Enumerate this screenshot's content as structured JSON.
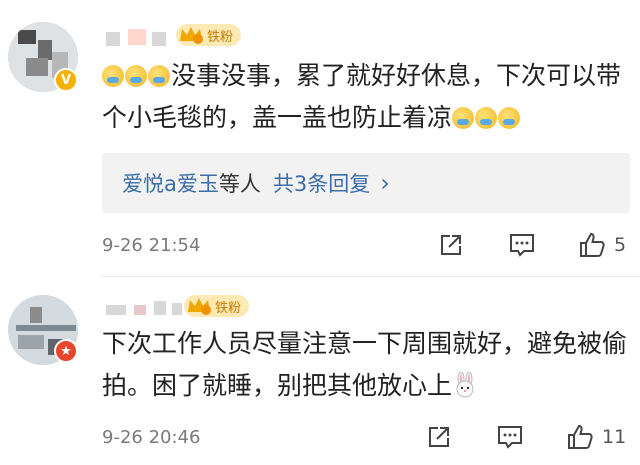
{
  "comments": [
    {
      "fan_badge": "铁粉",
      "text_a": "没事没事，累了就好好休息，下次可以带个小毛毯的，盖一盖也防止着凉",
      "replies": {
        "users": "爱悦a爱玉",
        "mid": "等人",
        "count": "共3条回复",
        "arrow": "›"
      },
      "time": "9-26 21:54",
      "likes": "5"
    },
    {
      "fan_badge": "铁粉",
      "text_a": "下次工作人员尽量注意一下周围就好，避免被偷拍。困了就睡，别把其他放心上",
      "time": "9-26 20:46",
      "likes": "11"
    }
  ],
  "icons": {
    "share": "share-icon",
    "comment": "comment-icon",
    "like": "thumbs-up-icon",
    "verified": "verified-badge-icon",
    "rabbit": "rabbit-emoji-icon",
    "emoji": "pray-emoji-icon"
  },
  "colors": {
    "link": "#3b6ea8",
    "badge_bg": "#fde9b4",
    "reply_bg": "#f2f2f2"
  }
}
